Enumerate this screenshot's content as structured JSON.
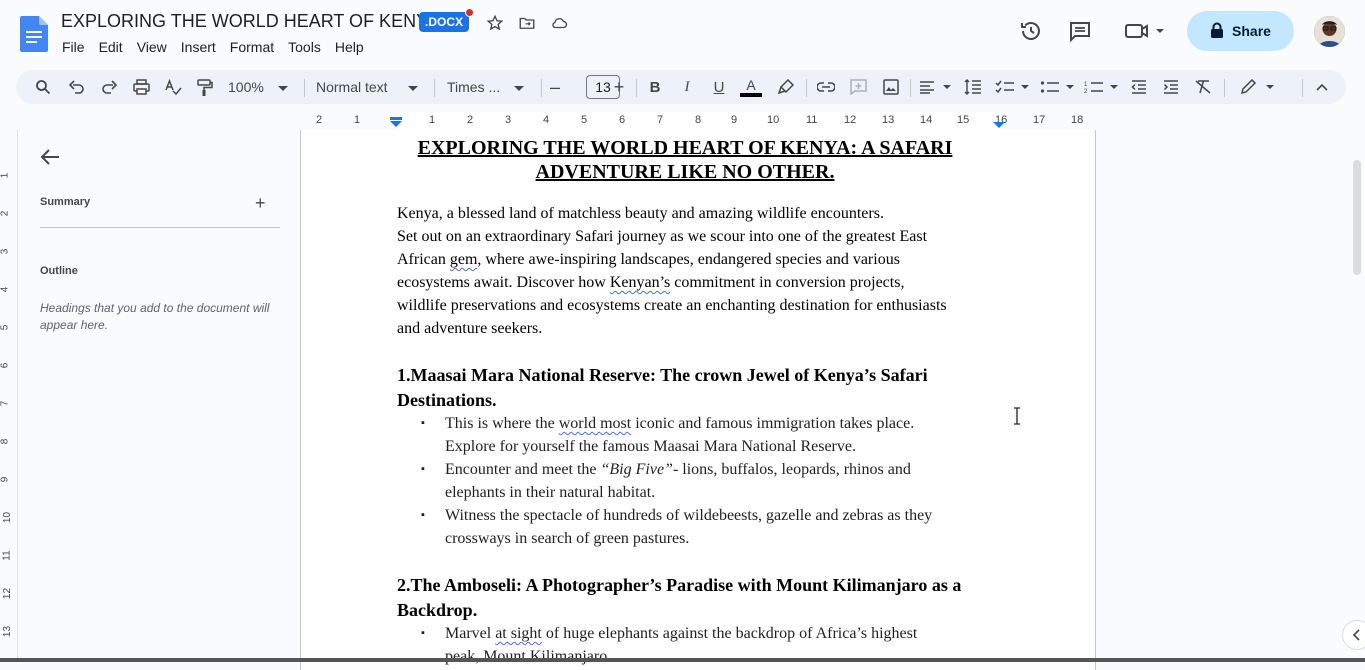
{
  "titlebar": {
    "title": "EXPLORING THE WORLD HEART OF KENYA",
    "badge": ".DOCX",
    "share_label": "Share"
  },
  "menu": [
    "File",
    "Edit",
    "View",
    "Insert",
    "Format",
    "Tools",
    "Help"
  ],
  "toolbar": {
    "zoom": "100%",
    "style": "Normal text",
    "font": "Times ...",
    "font_size": "13"
  },
  "ruler_numbers": [
    "2",
    "1",
    "1",
    "2",
    "3",
    "4",
    "5",
    "6",
    "7",
    "8",
    "9",
    "10",
    "11",
    "12",
    "13",
    "14",
    "15",
    "16",
    "17",
    "18"
  ],
  "vruler_numbers": [
    "1",
    "2",
    "3",
    "4",
    "5",
    "6",
    "7",
    "8",
    "9",
    "10",
    "11",
    "12",
    "13"
  ],
  "sidebar": {
    "summary": "Summary",
    "outline": "Outline",
    "outline_hint": "Headings that you add to the document will appear here."
  },
  "document": {
    "title_line1": "EXPLORING THE WORLD HEART OF KENYA: A SAFARI",
    "title_line2": "ADVENTURE LIKE NO OTHER.",
    "intro_l1": "Kenya, a blessed land of matchless beauty and amazing wildlife encounters.",
    "intro_l2": "Set out on an extraordinary Safari journey as we scour into one of the greatest East",
    "intro_l3a": "African ",
    "intro_l3b": "gem",
    "intro_l3c": ", where awe-inspiring landscapes, endangered species and various",
    "intro_l4a": "ecosystems await. Discover how ",
    "intro_l4b": "Kenyan’s",
    "intro_l4c": " commitment in conversion projects,",
    "intro_l5": "wildlife preservations and ecosystems create an enchanting destination for enthusiasts",
    "intro_l6": "and adventure seekers.",
    "sec1_l1": "1.Maasai Mara National Reserve: The crown Jewel of Kenya’s Safari",
    "sec1_l2": "Destinations.",
    "b1_l1a": "This is where the ",
    "b1_l1b": "world most",
    "b1_l1c": " iconic and famous immigration takes place.",
    "b1_l2": "Explore for yourself the famous Maasai Mara National Reserve.",
    "b2_l1a": "Encounter and meet the ",
    "b2_l1b": "“Big Five”",
    "b2_l1c": "- lions, buffalos, leopards, rhinos and",
    "b2_l2": "elephants in their natural habitat.",
    "b3_l1": "Witness the spectacle of hundreds of wildebeests, gazelle and zebras as they",
    "b3_l2": "crossways in search of green pastures.",
    "sec2_l1": "2.The Amboseli: A Photographer’s Paradise with Mount Kilimanjaro as a",
    "sec2_l2": "Backdrop.",
    "b4_l1a": "Marvel ",
    "b4_l1b": "at sight",
    "b4_l1c": " of huge elephants against the backdrop of Africa’s highest",
    "b4_l2": "peak, Mount Kilimanjaro.",
    "bullet_char": "▪"
  }
}
